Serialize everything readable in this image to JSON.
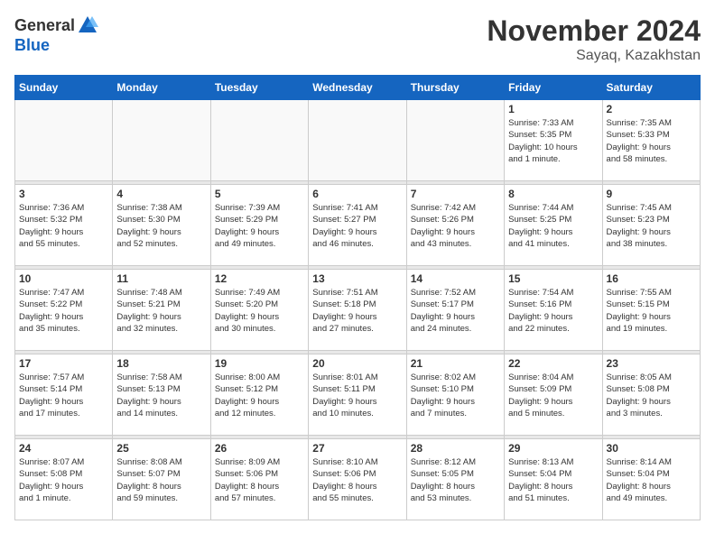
{
  "header": {
    "logo": {
      "general": "General",
      "blue": "Blue"
    },
    "title": "November 2024",
    "location": "Sayaq, Kazakhstan"
  },
  "calendar": {
    "weekdays": [
      "Sunday",
      "Monday",
      "Tuesday",
      "Wednesday",
      "Thursday",
      "Friday",
      "Saturday"
    ],
    "weeks": [
      [
        {
          "day": "",
          "info": ""
        },
        {
          "day": "",
          "info": ""
        },
        {
          "day": "",
          "info": ""
        },
        {
          "day": "",
          "info": ""
        },
        {
          "day": "",
          "info": ""
        },
        {
          "day": "1",
          "info": "Sunrise: 7:33 AM\nSunset: 5:35 PM\nDaylight: 10 hours\nand 1 minute."
        },
        {
          "day": "2",
          "info": "Sunrise: 7:35 AM\nSunset: 5:33 PM\nDaylight: 9 hours\nand 58 minutes."
        }
      ],
      [
        {
          "day": "3",
          "info": "Sunrise: 7:36 AM\nSunset: 5:32 PM\nDaylight: 9 hours\nand 55 minutes."
        },
        {
          "day": "4",
          "info": "Sunrise: 7:38 AM\nSunset: 5:30 PM\nDaylight: 9 hours\nand 52 minutes."
        },
        {
          "day": "5",
          "info": "Sunrise: 7:39 AM\nSunset: 5:29 PM\nDaylight: 9 hours\nand 49 minutes."
        },
        {
          "day": "6",
          "info": "Sunrise: 7:41 AM\nSunset: 5:27 PM\nDaylight: 9 hours\nand 46 minutes."
        },
        {
          "day": "7",
          "info": "Sunrise: 7:42 AM\nSunset: 5:26 PM\nDaylight: 9 hours\nand 43 minutes."
        },
        {
          "day": "8",
          "info": "Sunrise: 7:44 AM\nSunset: 5:25 PM\nDaylight: 9 hours\nand 41 minutes."
        },
        {
          "day": "9",
          "info": "Sunrise: 7:45 AM\nSunset: 5:23 PM\nDaylight: 9 hours\nand 38 minutes."
        }
      ],
      [
        {
          "day": "10",
          "info": "Sunrise: 7:47 AM\nSunset: 5:22 PM\nDaylight: 9 hours\nand 35 minutes."
        },
        {
          "day": "11",
          "info": "Sunrise: 7:48 AM\nSunset: 5:21 PM\nDaylight: 9 hours\nand 32 minutes."
        },
        {
          "day": "12",
          "info": "Sunrise: 7:49 AM\nSunset: 5:20 PM\nDaylight: 9 hours\nand 30 minutes."
        },
        {
          "day": "13",
          "info": "Sunrise: 7:51 AM\nSunset: 5:18 PM\nDaylight: 9 hours\nand 27 minutes."
        },
        {
          "day": "14",
          "info": "Sunrise: 7:52 AM\nSunset: 5:17 PM\nDaylight: 9 hours\nand 24 minutes."
        },
        {
          "day": "15",
          "info": "Sunrise: 7:54 AM\nSunset: 5:16 PM\nDaylight: 9 hours\nand 22 minutes."
        },
        {
          "day": "16",
          "info": "Sunrise: 7:55 AM\nSunset: 5:15 PM\nDaylight: 9 hours\nand 19 minutes."
        }
      ],
      [
        {
          "day": "17",
          "info": "Sunrise: 7:57 AM\nSunset: 5:14 PM\nDaylight: 9 hours\nand 17 minutes."
        },
        {
          "day": "18",
          "info": "Sunrise: 7:58 AM\nSunset: 5:13 PM\nDaylight: 9 hours\nand 14 minutes."
        },
        {
          "day": "19",
          "info": "Sunrise: 8:00 AM\nSunset: 5:12 PM\nDaylight: 9 hours\nand 12 minutes."
        },
        {
          "day": "20",
          "info": "Sunrise: 8:01 AM\nSunset: 5:11 PM\nDaylight: 9 hours\nand 10 minutes."
        },
        {
          "day": "21",
          "info": "Sunrise: 8:02 AM\nSunset: 5:10 PM\nDaylight: 9 hours\nand 7 minutes."
        },
        {
          "day": "22",
          "info": "Sunrise: 8:04 AM\nSunset: 5:09 PM\nDaylight: 9 hours\nand 5 minutes."
        },
        {
          "day": "23",
          "info": "Sunrise: 8:05 AM\nSunset: 5:08 PM\nDaylight: 9 hours\nand 3 minutes."
        }
      ],
      [
        {
          "day": "24",
          "info": "Sunrise: 8:07 AM\nSunset: 5:08 PM\nDaylight: 9 hours\nand 1 minute."
        },
        {
          "day": "25",
          "info": "Sunrise: 8:08 AM\nSunset: 5:07 PM\nDaylight: 8 hours\nand 59 minutes."
        },
        {
          "day": "26",
          "info": "Sunrise: 8:09 AM\nSunset: 5:06 PM\nDaylight: 8 hours\nand 57 minutes."
        },
        {
          "day": "27",
          "info": "Sunrise: 8:10 AM\nSunset: 5:06 PM\nDaylight: 8 hours\nand 55 minutes."
        },
        {
          "day": "28",
          "info": "Sunrise: 8:12 AM\nSunset: 5:05 PM\nDaylight: 8 hours\nand 53 minutes."
        },
        {
          "day": "29",
          "info": "Sunrise: 8:13 AM\nSunset: 5:04 PM\nDaylight: 8 hours\nand 51 minutes."
        },
        {
          "day": "30",
          "info": "Sunrise: 8:14 AM\nSunset: 5:04 PM\nDaylight: 8 hours\nand 49 minutes."
        }
      ]
    ]
  }
}
